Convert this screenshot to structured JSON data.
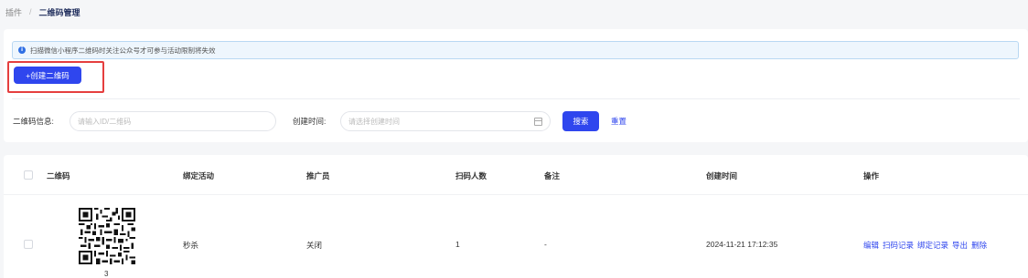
{
  "breadcrumb": {
    "parent": "插件",
    "separator": "/",
    "current": "二维码管理"
  },
  "notice": {
    "text": "扫描微信小程序二维码时关注公众号才可参与活动限制将失效",
    "icon": "info-icon"
  },
  "create_button": {
    "label": "+创建二维码"
  },
  "filters": {
    "qr_info_label": "二维码信息:",
    "qr_info_placeholder": "请输入ID/二维码",
    "created_label": "创建时间:",
    "created_placeholder": "请选择创建时间",
    "search_label": "搜索",
    "reset_label": "重置"
  },
  "table": {
    "columns": [
      "二维码",
      "绑定活动",
      "推广员",
      "扫码人数",
      "备注",
      "创建时间",
      "操作"
    ],
    "rows": [
      {
        "qr_id": "3",
        "activity": "秒杀",
        "promoter": "关闭",
        "scans": "1",
        "remark": "-",
        "created": "2024-11-21 17:12:35",
        "actions": [
          "编辑",
          "扫码记录",
          "绑定记录",
          "导出",
          "删除"
        ]
      }
    ]
  },
  "colors": {
    "primary": "#2f46ee",
    "highlight_box": "#e53e3e",
    "notice_bg": "#eef6fd"
  }
}
